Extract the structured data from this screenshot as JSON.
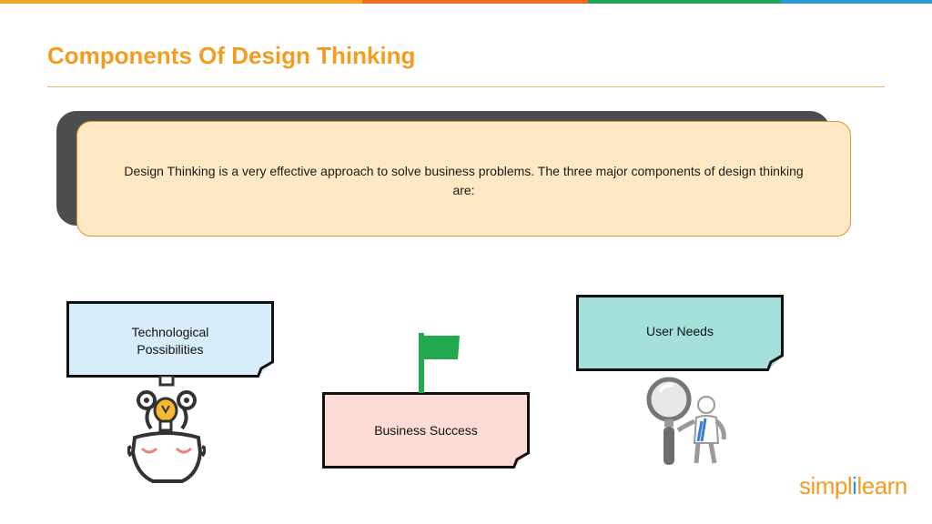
{
  "slide": {
    "title": "Components Of Design Thinking",
    "intro": "Design Thinking is a very effective approach to solve business problems. The three major components of design thinking are:",
    "components": [
      {
        "label_line1": "Technological",
        "label_line2": "Possibilities"
      },
      {
        "label": "Business Success"
      },
      {
        "label": "User Needs"
      }
    ]
  },
  "brand": {
    "logo_part1": "simpl",
    "logo_part2": "i",
    "logo_part3": "learn"
  },
  "colors": {
    "accent": "#f39c1f",
    "topbar": [
      "#f5a623",
      "#ef6c1f",
      "#22a65a",
      "#2a9ad6"
    ]
  },
  "icons": [
    "head-lightbulb-icon",
    "green-flag-icon",
    "magnifier-person-icon"
  ]
}
